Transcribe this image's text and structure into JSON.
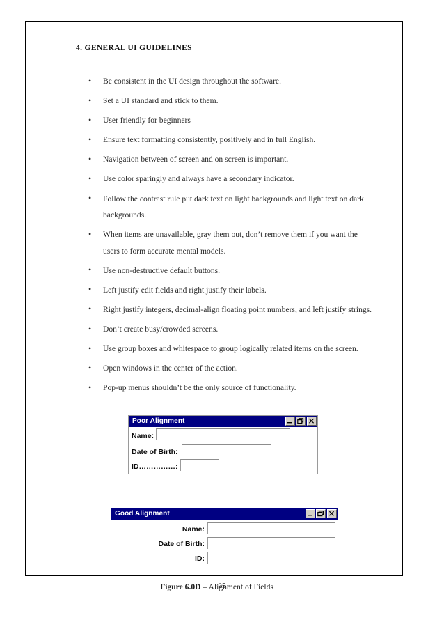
{
  "document": {
    "section_heading": "4. GENERAL UI GUIDELINES",
    "page_number": "25"
  },
  "guidelines": [
    "Be consistent in the UI design throughout the software.",
    "Set a UI standard and stick to them.",
    "User friendly for beginners",
    "Ensure text formatting consistently, positively and in full English.",
    "Navigation between of screen and on screen is important.",
    "Use color sparingly and always have a secondary indicator.",
    "Follow the contrast rule    put dark text on light backgrounds and light text on dark backgrounds.",
    "When items are unavailable, gray them out, don’t remove them if you want the users to form accurate mental models.",
    "Use non-destructive default buttons.",
    "Left justify edit fields and right justify their labels.",
    "Right justify integers, decimal-align floating point numbers, and left justify strings.",
    "Don’t create busy/crowded screens.",
    "Use group boxes and whitespace to group logically related items on the screen.",
    "Open windows in the center of the action.",
    "Pop-up menus shouldn’t be the only source of functionality."
  ],
  "figure": {
    "caption_label": "Figure 6.0D",
    "caption_text": " – Alignment of Fields",
    "titlebar_color": "#000082",
    "poor_window": {
      "title": "Poor Alignment",
      "fields": [
        {
          "label": "Name:",
          "value": ""
        },
        {
          "label": "Date of Birth:",
          "value": ""
        },
        {
          "label": "ID……………:",
          "value": ""
        }
      ],
      "buttons": [
        {
          "name": "minimize",
          "label": "_"
        },
        {
          "name": "restore",
          "label": "❐"
        },
        {
          "name": "close",
          "label": "×"
        }
      ]
    },
    "good_window": {
      "title": "Good Alignment",
      "fields": [
        {
          "label": "Name:",
          "value": ""
        },
        {
          "label": "Date of Birth:",
          "value": ""
        },
        {
          "label": "ID:",
          "value": ""
        }
      ],
      "buttons": [
        {
          "name": "minimize",
          "label": "_"
        },
        {
          "name": "restore",
          "label": "❐"
        },
        {
          "name": "close",
          "label": "×"
        }
      ]
    }
  }
}
